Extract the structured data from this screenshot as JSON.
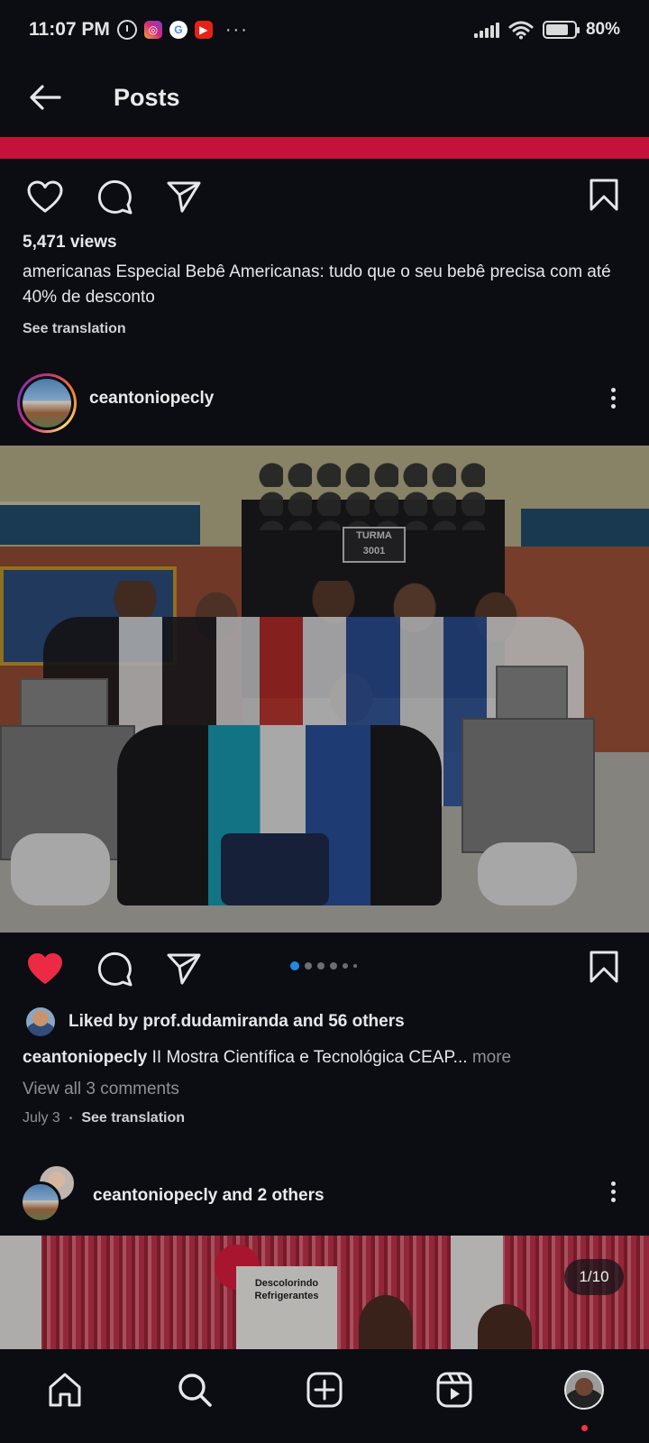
{
  "status_bar": {
    "time": "11:07 PM",
    "battery": "80%",
    "more": "···",
    "icons": [
      "alarm-icon",
      "instagram-icon",
      "google-icon",
      "youtube-icon",
      "signal-icon",
      "wifi-icon",
      "battery-icon"
    ]
  },
  "header": {
    "title": "Posts"
  },
  "post1": {
    "views": "5,471 views",
    "caption": "americanas Especial Bebê Americanas: tudo que o seu bebê precisa com até 40% de desconto",
    "see_translation": "See translation"
  },
  "post2": {
    "username": "ceantoniopecly",
    "photo_sign": "TURMA 3001",
    "liked_by": "Liked by prof.dudamiranda and 56 others",
    "caption_user": "ceantoniopecly",
    "caption_text": "II Mostra Científica e Tecnológica CEAP...",
    "more": "more",
    "view_comments": "View all 3 comments",
    "date": "July 3",
    "separator": "•",
    "see_translation": "See translation",
    "liked": true,
    "carousel_dots": 6
  },
  "post3": {
    "username": "ceantoniopecly and 2 others",
    "sign_text": "Descolorindo Refrigerantes",
    "counter": "1/10"
  },
  "colors": {
    "background": "#0b0d12",
    "banner_red": "#c4123a",
    "like_red": "#ed2a44",
    "carousel_active": "#1d8ce0",
    "notification": "#ff3040"
  }
}
